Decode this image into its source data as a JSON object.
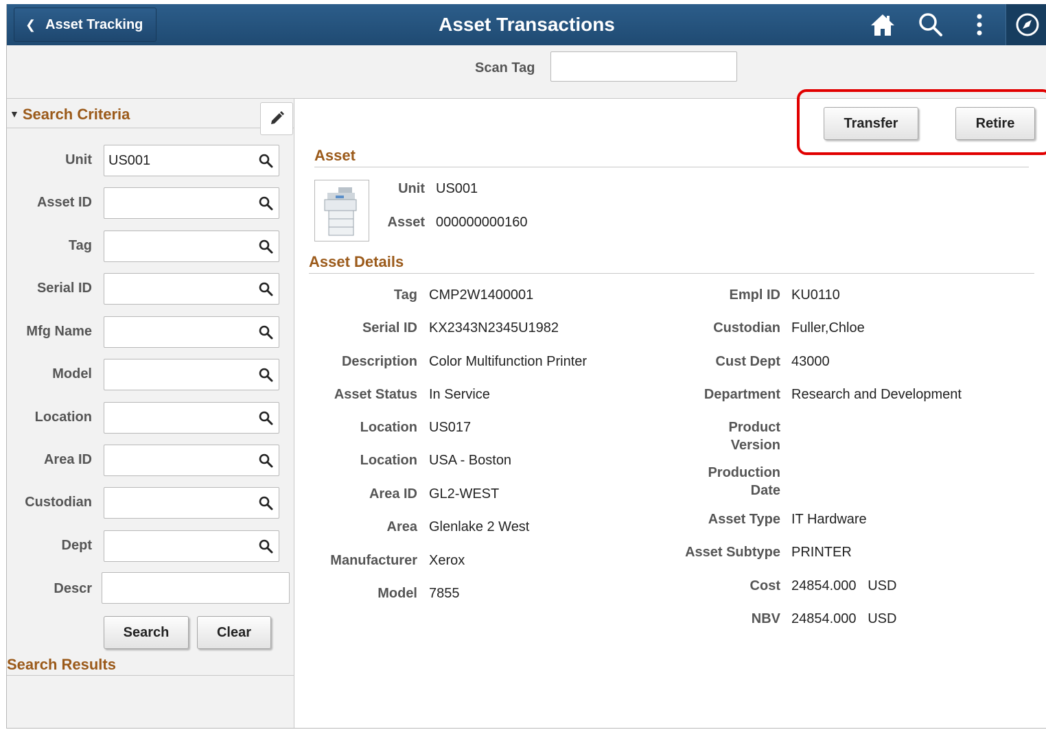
{
  "header": {
    "back_label": "Asset Tracking",
    "title": "Asset Transactions",
    "icons": [
      "home-icon",
      "search-icon",
      "more-vertical-icon",
      "navigator-compass-icon"
    ]
  },
  "scan": {
    "label": "Scan Tag",
    "value": ""
  },
  "search_criteria": {
    "title": "Search Criteria",
    "fields": [
      {
        "label": "Unit",
        "value": "US001"
      },
      {
        "label": "Asset ID",
        "value": ""
      },
      {
        "label": "Tag",
        "value": ""
      },
      {
        "label": "Serial ID",
        "value": ""
      },
      {
        "label": "Mfg Name",
        "value": ""
      },
      {
        "label": "Model",
        "value": ""
      },
      {
        "label": "Location",
        "value": ""
      },
      {
        "label": "Area ID",
        "value": ""
      },
      {
        "label": "Custodian",
        "value": ""
      },
      {
        "label": "Dept",
        "value": ""
      }
    ],
    "descr_label": "Descr",
    "search_label": "Search",
    "clear_label": "Clear",
    "results_title": "Search Results"
  },
  "actions": {
    "transfer_label": "Transfer",
    "retire_label": "Retire",
    "highlight_color": "#e10000"
  },
  "asset": {
    "title": "Asset",
    "unit_label": "Unit",
    "unit_value": "US001",
    "asset_label": "Asset",
    "asset_value": "000000000160"
  },
  "details": {
    "title": "Asset Details",
    "left": [
      {
        "label": "Tag",
        "value": "CMP2W1400001"
      },
      {
        "label": "Serial ID",
        "value": "KX2343N2345U1982"
      },
      {
        "label": "Description",
        "value": "Color Multifunction Printer"
      },
      {
        "label": "Asset Status",
        "value": "In Service"
      },
      {
        "label": "Location",
        "value": "US017"
      },
      {
        "label": "Location",
        "value": "USA - Boston"
      },
      {
        "label": "Area ID",
        "value": "GL2-WEST"
      },
      {
        "label": "Area",
        "value": "Glenlake 2 West"
      },
      {
        "label": "Manufacturer",
        "value": "Xerox"
      },
      {
        "label": "Model",
        "value": "7855"
      }
    ],
    "right": [
      {
        "label": "Empl ID",
        "value": "KU0110"
      },
      {
        "label": "Custodian",
        "value": "Fuller,Chloe"
      },
      {
        "label": "Cust Dept",
        "value": "43000"
      },
      {
        "label": "Department",
        "value": "Research and Development"
      },
      {
        "label": "Product Version",
        "value": ""
      },
      {
        "label": "Production Date",
        "value": ""
      },
      {
        "label": "Asset Type",
        "value": "IT Hardware"
      },
      {
        "label": "Asset Subtype",
        "value": "PRINTER"
      },
      {
        "label": "Cost",
        "value": "24854.000   USD"
      },
      {
        "label": "NBV",
        "value": "24854.000   USD"
      }
    ]
  },
  "colors": {
    "header_bg": "#24517c",
    "section_title": "#9b5a1a",
    "panel_bg": "#f2f2f2"
  }
}
